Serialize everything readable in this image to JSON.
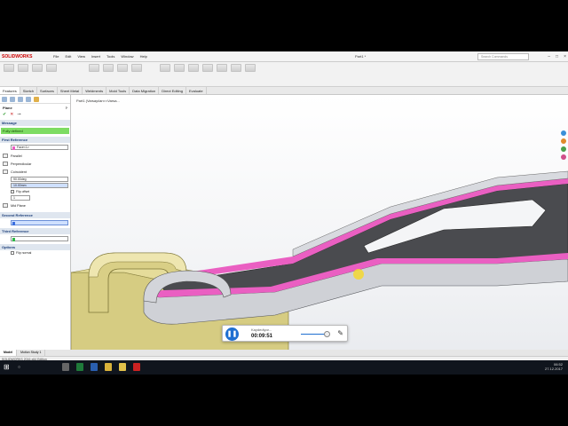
{
  "app": {
    "logo_text": "SOLIDWORKS",
    "menus": [
      "File",
      "Edit",
      "View",
      "Insert",
      "Tools",
      "Window",
      "Help"
    ],
    "document_title": "Part1 *",
    "search_placeholder": "Search Commands"
  },
  "tabs": [
    "Features",
    "Sketch",
    "Surfaces",
    "Sheet Metal",
    "Weldments",
    "Mold Tools",
    "Data Migration",
    "Direct Editing",
    "Evaluate"
  ],
  "active_tab": "Features",
  "panel": {
    "title": "Plane",
    "help": "?",
    "ok": "✔",
    "cancel": "✕",
    "pin": "⊸",
    "message_header": "Message",
    "message": "Fully defined",
    "first_reference_header": "First Reference",
    "first_reference_value": "Face<1>",
    "options_first": [
      "Parallel",
      "Perpendicular",
      "Coincident"
    ],
    "angle_value": "90.00deg",
    "distance_value": "10.00mm",
    "flip_offset_label": "Flip offset",
    "count_value": "1",
    "mid_plane_label": "Mid Plane",
    "second_reference_header": "Second Reference",
    "third_reference_header": "Third Reference",
    "options_header": "Options",
    "flip_normal_label": "Flip normal"
  },
  "viewport": {
    "breadcrumb": "Part1 (Varsayılan<<Varsa..."
  },
  "bottom_tabs": [
    "Model",
    "Motion Study 1"
  ],
  "statusbar": "SOLIDWORKS 2016 x64 Edition",
  "recorder": {
    "label": "Kaydediyor...",
    "time": "00:09:51",
    "pause_icon": "❚❚",
    "pen_icon": "✎"
  },
  "taskbar": {
    "search": "",
    "time": "06:52",
    "date": "27.12.2017"
  },
  "colors": {
    "accent": "#1f6fd1",
    "pink_face": "#ea5fc2",
    "olive_part": "#d6cc82",
    "fully_defined": "#7ddc63"
  }
}
